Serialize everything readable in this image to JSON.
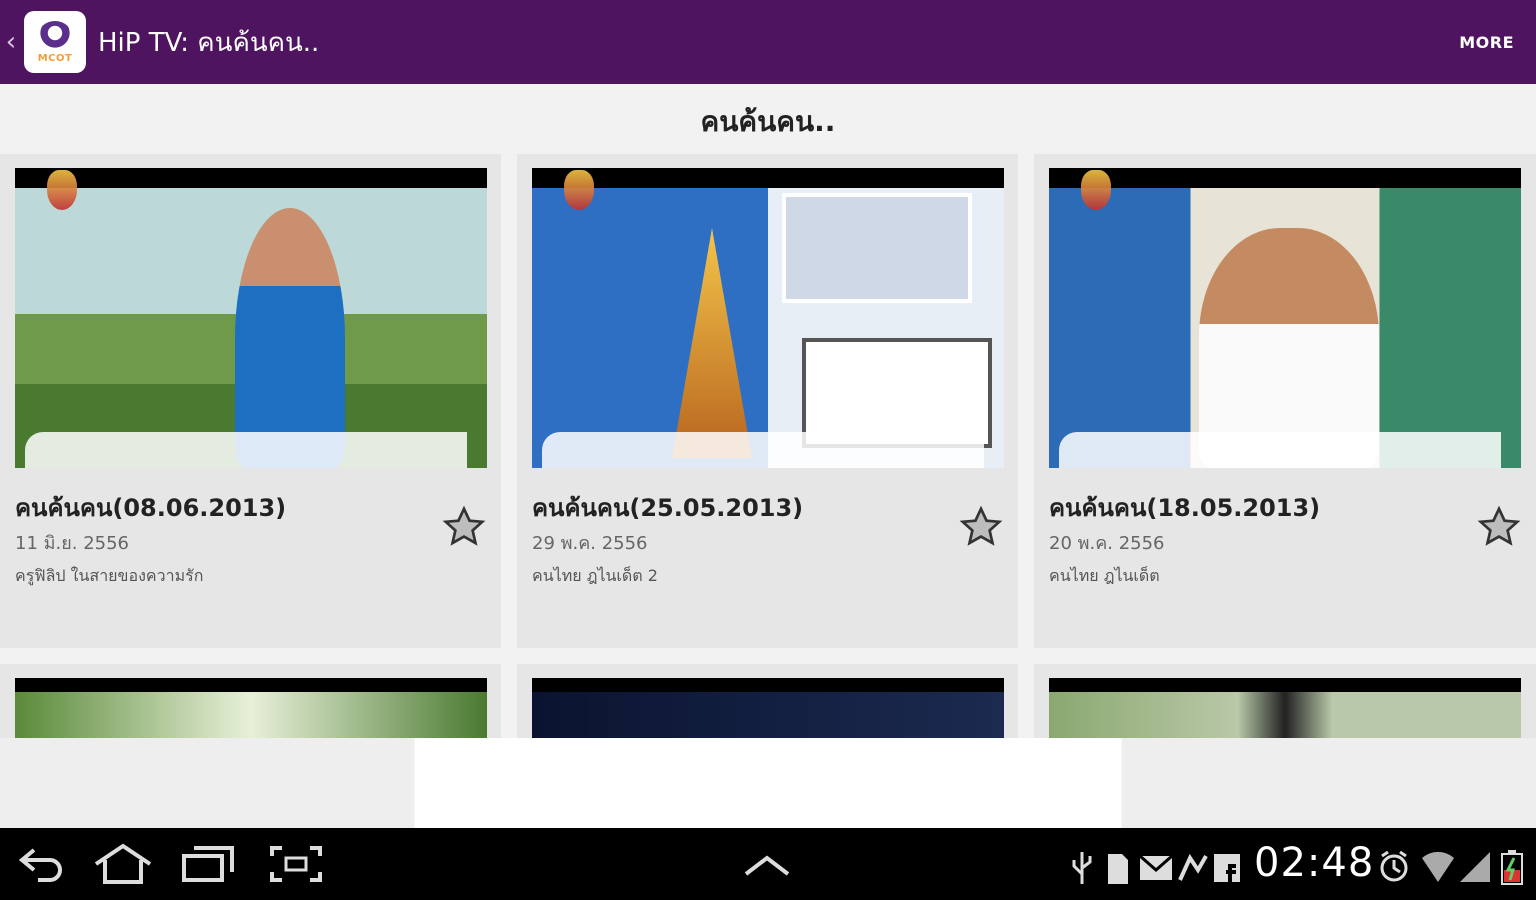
{
  "actionbar": {
    "app_icon_label": "MCOT",
    "title": "HiP TV: คนค้นคน..",
    "more_label": "MORE",
    "color": "#4f1460"
  },
  "section": {
    "title": "คนค้นคน.."
  },
  "cards": [
    {
      "title": "คนค้นคน(08.06.2013)",
      "date": "11 มิ.ย. 2556",
      "desc": "ครูฟิลิป ในสายของความรัก"
    },
    {
      "title": "คนค้นคน(25.05.2013)",
      "date": "29 พ.ค. 2556",
      "desc": "คนไทย ฎไนเด็ต 2"
    },
    {
      "title": "คนค้นคน(18.05.2013)",
      "date": "20 พ.ค. 2556",
      "desc": "คนไทย ฎไนเด็ต"
    }
  ],
  "statusbar": {
    "time": "02:48"
  },
  "icons": {
    "back": "back-icon",
    "home": "home-icon",
    "recents": "recent-apps-icon",
    "screenshot": "screenshot-icon",
    "up": "chevron-up-icon",
    "star": "star-icon"
  }
}
